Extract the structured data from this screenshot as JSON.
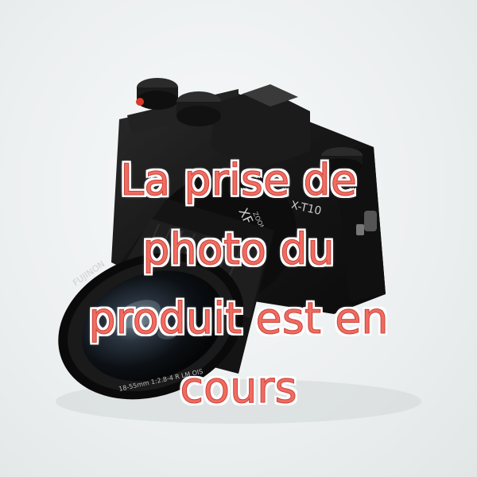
{
  "caption": {
    "line1": "La prise de",
    "line2": "photo du",
    "line3": "produit est en",
    "line4": "cours"
  },
  "camera_markings": {
    "model": "X-T10",
    "mount": "XF",
    "zoom": "ZOOM",
    "brand": "FUJINON",
    "lens_spec": "18-55mm 1:2.8-4 R LM OIS"
  },
  "colors": {
    "caption_fill": "#f06b60",
    "caption_outline": "#ffffff",
    "background": "#eef1f1",
    "camera_body": "#141414"
  }
}
